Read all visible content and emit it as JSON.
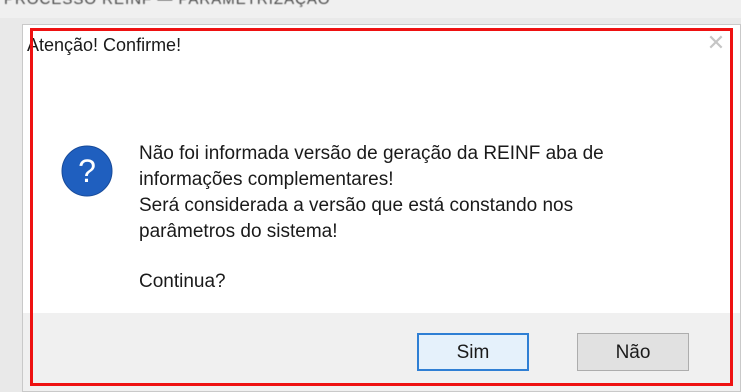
{
  "background": {
    "cut_text": "PROCESSO REINF — PARAMETRIZAÇÃO"
  },
  "dialog": {
    "title": "Atenção! Confirme!",
    "close_icon": "close-icon",
    "icon": "question-icon",
    "message": {
      "line1": "Não foi informada versão de geração da REINF aba de",
      "line2": "informações complementares!",
      "line3": "Será considerada a versão que está constando nos",
      "line4": "parâmetros do sistema!",
      "line5": "Continua?"
    },
    "buttons": {
      "yes_label": "Sim",
      "no_label": "Não"
    }
  },
  "colors": {
    "highlight": "#ee1111",
    "icon_blue": "#1f5fbf",
    "focus_border": "#2f7fd4"
  }
}
